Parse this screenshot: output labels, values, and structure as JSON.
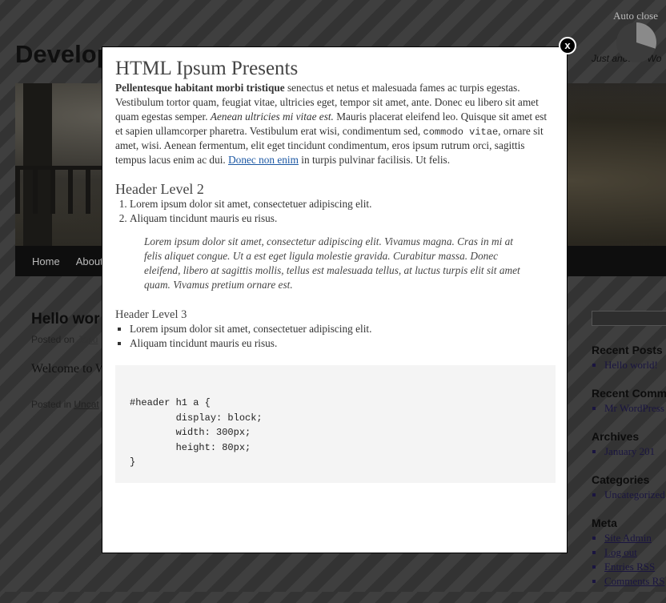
{
  "site": {
    "title": "Develop",
    "tagline": "Just another Wo"
  },
  "nav": {
    "items": [
      "Home",
      "About"
    ]
  },
  "post": {
    "title": "Hello wor",
    "meta_prefix": "Posted on",
    "meta_link": "Janu",
    "body": "Welcome to W",
    "footer_prefix": "Posted in",
    "footer_link": "Uncat"
  },
  "sidebar": {
    "sections": [
      {
        "heading": "Recent Posts",
        "items": [
          "Hello world!"
        ]
      },
      {
        "heading": "Recent Comm",
        "items": [
          "Mr WordPress"
        ]
      },
      {
        "heading": "Archives",
        "items": [
          "January 201"
        ]
      },
      {
        "heading": "Categories",
        "items": [
          "Uncategorized"
        ]
      }
    ],
    "meta": {
      "heading": "Meta",
      "items": [
        "Site Admin",
        "Log out",
        "Entries RSS",
        "Comments RS"
      ]
    }
  },
  "lightbox": {
    "autoclose_label": "Auto close",
    "autoclose_progress": 0.3,
    "close_label": "x",
    "title": "HTML Ipsum Presents",
    "intro": {
      "strong": "Pellentesque habitant morbi tristique",
      "text1": " senectus et netus et malesuada fames ac turpis egestas. Vestibulum tortor quam, feugiat vitae, ultricies eget, tempor sit amet, ante. Donec eu libero sit amet quam egestas semper. ",
      "em": "Aenean ultricies mi vitae est.",
      "text2": " Mauris placerat eleifend leo. Quisque sit amet est et sapien ullamcorper pharetra. Vestibulum erat wisi, condimentum sed, ",
      "code": "commodo vitae",
      "text3": ", ornare sit amet, wisi. Aenean fermentum, elit eget tincidunt condimentum, eros ipsum rutrum orci, sagittis tempus lacus enim ac dui. ",
      "link": "Donec non enim",
      "text4": " in turpis pulvinar facilisis. Ut felis."
    },
    "h2": "Header Level 2",
    "ordered": [
      "Lorem ipsum dolor sit amet, consectetuer adipiscing elit.",
      "Aliquam tincidunt mauris eu risus."
    ],
    "quote": "Lorem ipsum dolor sit amet, consectetur adipiscing elit. Vivamus magna. Cras in mi at felis aliquet congue. Ut a est eget ligula molestie gravida. Curabitur massa. Donec eleifend, libero at sagittis mollis, tellus est malesuada tellus, at luctus turpis elit sit amet quam. Vivamus pretium ornare est.",
    "h3": "Header Level 3",
    "unordered": [
      "Lorem ipsum dolor sit amet, consectetuer adipiscing elit.",
      "Aliquam tincidunt mauris eu risus."
    ],
    "code_block": "#header h1 a {\n\tdisplay: block;\n\twidth: 300px;\n\theight: 80px;\n}"
  }
}
